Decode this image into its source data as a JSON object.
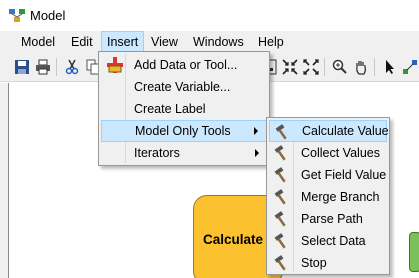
{
  "window": {
    "title": "Model"
  },
  "menubar": {
    "items": [
      {
        "label": "Model"
      },
      {
        "label": "Edit"
      },
      {
        "label": "Insert"
      },
      {
        "label": "View"
      },
      {
        "label": "Windows"
      },
      {
        "label": "Help"
      }
    ]
  },
  "insert_menu": {
    "items": [
      {
        "label": "Add Data or Tool..."
      },
      {
        "label": "Create Variable..."
      },
      {
        "label": "Create Label"
      },
      {
        "label": "Model Only Tools"
      },
      {
        "label": "Iterators"
      }
    ]
  },
  "model_only_tools": {
    "items": [
      {
        "label": "Calculate Value"
      },
      {
        "label": "Collect Values"
      },
      {
        "label": "Get Field Value"
      },
      {
        "label": "Merge Branch"
      },
      {
        "label": "Parse Path"
      },
      {
        "label": "Select Data"
      },
      {
        "label": "Stop"
      }
    ]
  },
  "canvas": {
    "process_label": "Calculate"
  },
  "colors": {
    "menu_highlight": "#cce8ff",
    "process_fill": "#fcc12e",
    "chrome": "#f0f0f0"
  }
}
